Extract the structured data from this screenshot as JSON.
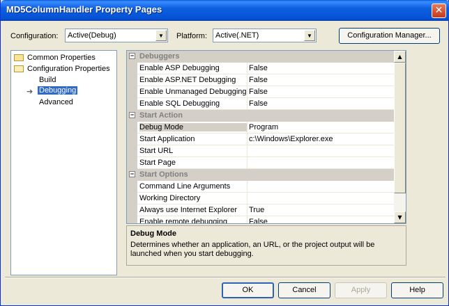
{
  "window": {
    "title": "MD5ColumnHandler Property Pages",
    "close_glyph": "✕"
  },
  "toolbar": {
    "configuration_label": "Configuration:",
    "configuration_value": "Active(Debug)",
    "platform_label": "Platform:",
    "platform_value": "Active(.NET)",
    "config_manager_label": "Configuration Manager..."
  },
  "tree": {
    "common_properties": "Common Properties",
    "configuration_properties": "Configuration Properties",
    "build": "Build",
    "debugging": "Debugging",
    "advanced": "Advanced",
    "arrow_glyph": "➔"
  },
  "grid": {
    "categories": {
      "debuggers": "Debuggers",
      "start_action": "Start Action",
      "start_options": "Start Options"
    },
    "rows": [
      {
        "name": "Enable ASP Debugging",
        "value": "False"
      },
      {
        "name": "Enable ASP.NET Debugging",
        "value": "False"
      },
      {
        "name": "Enable Unmanaged Debugging",
        "value": "False"
      },
      {
        "name": "Enable SQL Debugging",
        "value": "False"
      },
      {
        "name": "Debug Mode",
        "value": "Program"
      },
      {
        "name": "Start Application",
        "value": "c:\\Windows\\Explorer.exe"
      },
      {
        "name": "Start URL",
        "value": ""
      },
      {
        "name": "Start Page",
        "value": ""
      },
      {
        "name": "Command Line Arguments",
        "value": ""
      },
      {
        "name": "Working Directory",
        "value": ""
      },
      {
        "name": "Always use Internet Explorer",
        "value": "True"
      },
      {
        "name": "Enable remote debugging",
        "value": "False"
      }
    ],
    "collapse_glyph": "−"
  },
  "description": {
    "title": "Debug Mode",
    "text": "Determines whether an application, an URL, or the project output will be launched when you start debugging."
  },
  "buttons": {
    "ok": "OK",
    "cancel": "Cancel",
    "apply": "Apply",
    "help": "Help"
  },
  "icons": {
    "scroll_up": "▲",
    "scroll_down": "▼",
    "dropdown": "▼"
  }
}
